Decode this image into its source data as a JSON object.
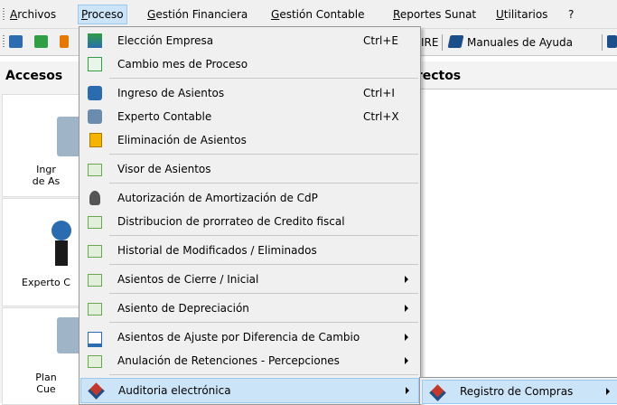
{
  "menubar": {
    "items": [
      {
        "label": "Archivos",
        "mnemonic": "A",
        "rest": "rchivos"
      },
      {
        "label": "Proceso",
        "mnemonic": "P",
        "rest": "roceso"
      },
      {
        "label": "Gestión Financiera",
        "mnemonic": "G",
        "rest": "estión Financiera"
      },
      {
        "label": "Gestión Contable",
        "mnemonic": "G",
        "rest": "estión Contable"
      },
      {
        "label": "Reportes Sunat",
        "mnemonic": "R",
        "rest": "eportes Sunat"
      },
      {
        "label": "Utilitarios",
        "mnemonic": "U",
        "rest": "tilitarios"
      },
      {
        "label": "?"
      }
    ]
  },
  "toolbar": {
    "partial_label": "IRE",
    "manuales_label": "Manuales de Ayuda"
  },
  "left_panel": {
    "title": "Accesos",
    "tiles": [
      {
        "line1": "Ingr",
        "line2": "de As"
      },
      {
        "line1": "Experto C"
      },
      {
        "line1": "Plan",
        "line2": "Cue"
      }
    ]
  },
  "right_panel": {
    "title": "irectos"
  },
  "dropdown": {
    "items": [
      {
        "label": "Elección Empresa",
        "shortcut": "Ctrl+E",
        "icon": "company-icon"
      },
      {
        "label": "Cambio mes de Proceso",
        "icon": "calendar-icon"
      },
      {
        "label": "Ingreso de Asientos",
        "shortcut": "Ctrl+I",
        "icon": "entry-icon"
      },
      {
        "label": "Experto Contable",
        "shortcut": "Ctrl+X",
        "icon": "expert-icon"
      },
      {
        "label": "Eliminación de Asientos",
        "icon": "clipboard-icon"
      },
      {
        "label": "Visor de Asientos",
        "icon": "list-icon"
      },
      {
        "label": "Autorización de Amortización de CdP",
        "icon": "user-icon"
      },
      {
        "label": "Distribucion de prorrateo de Credito fiscal",
        "icon": "list-icon"
      },
      {
        "label": "Historial de Modificados / Eliminados",
        "icon": "list-icon"
      },
      {
        "label": "Asientos de Cierre / Inicial",
        "icon": "list-icon",
        "submenu": true
      },
      {
        "label": "Asiento de Depreciación",
        "icon": "list-icon",
        "submenu": true
      },
      {
        "label": "Asientos de Ajuste por Diferencia de Cambio",
        "icon": "chart-icon",
        "submenu": true
      },
      {
        "label": "Anulación de Retenciones - Percepciones",
        "icon": "list-icon",
        "submenu": true
      },
      {
        "label": "Auditoria electrónica",
        "icon": "audit-icon",
        "submenu": true
      }
    ]
  },
  "submenu": {
    "items": [
      {
        "label": "Registro de Compras",
        "icon": "audit-icon",
        "submenu": true
      }
    ]
  }
}
